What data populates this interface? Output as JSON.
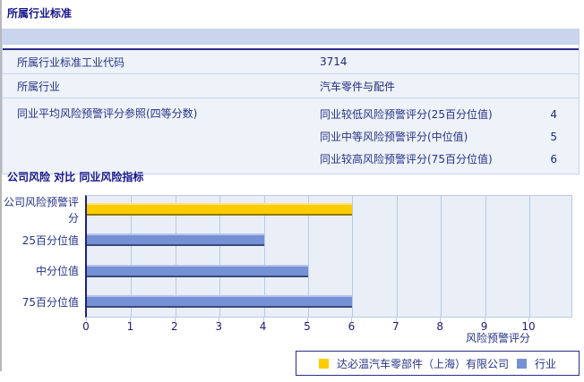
{
  "section1": {
    "title": "所属行业标准",
    "table": {
      "rows": [
        {
          "label": "所属行业标准工业代码",
          "value": "3714"
        },
        {
          "label": "所属行业",
          "value": "汽车零件与配件"
        }
      ],
      "group_row": {
        "label": "同业平均风险预警评分参照(四等分数)",
        "items": [
          {
            "label": "同业较低风险预警评分(25百分位值)",
            "value": "4"
          },
          {
            "label": "同业中等风险预警评分(中位值)",
            "value": "5"
          },
          {
            "label": "同业较高风险预警评分(75百分位值)",
            "value": "6"
          }
        ]
      }
    }
  },
  "section2": {
    "title": "公司风险 对比 同业风险指标"
  },
  "chart_data": {
    "type": "bar",
    "orientation": "horizontal",
    "title": "公司风险 对比 同业风险指标",
    "categories": [
      "公司风险预警评分",
      "25百分位值",
      "中分位值",
      "75百分位值"
    ],
    "values": [
      6,
      4,
      5,
      6
    ],
    "series_of_bar": [
      "company",
      "industry",
      "industry",
      "industry"
    ],
    "xlabel": "风险预警评分",
    "xlim": [
      0,
      10
    ],
    "xticks": [
      0,
      1,
      2,
      3,
      4,
      5,
      6,
      7,
      8,
      9,
      10
    ],
    "grid": "vertical",
    "legend_position": "bottom-right",
    "legend": [
      {
        "series": "company",
        "label": "达必温汽车零部件（上海）有限公司"
      },
      {
        "series": "industry",
        "label": "行业"
      }
    ],
    "colors": {
      "company": {
        "main": "#ffcc00",
        "light": "#ffe27a",
        "dark": "#8f7a00"
      },
      "industry": {
        "main": "#7590d4",
        "light": "#b3c3ea",
        "dark": "#39497a"
      },
      "plot_background": "#e9eef7",
      "gridline": "#b9c9e6",
      "axis": "#20207a"
    }
  }
}
